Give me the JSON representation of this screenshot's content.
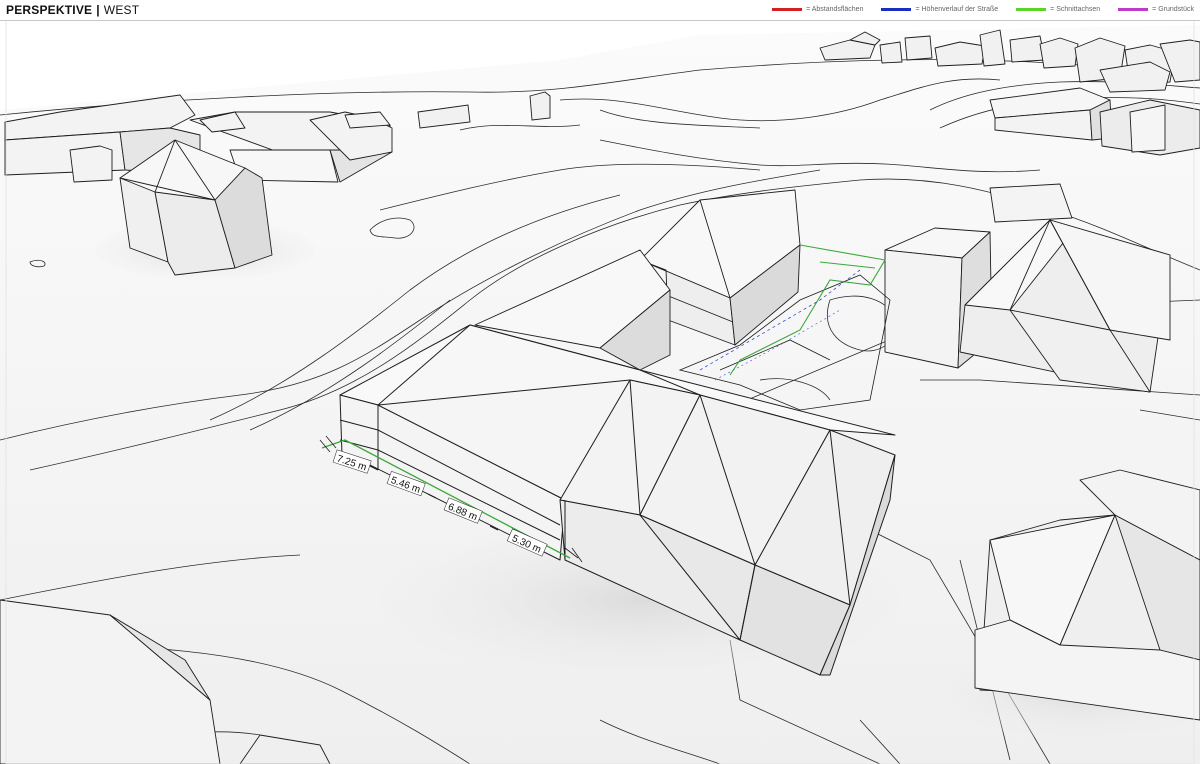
{
  "header": {
    "title_main": "PERSPEKTIVE",
    "title_separator": "|",
    "title_view": "WEST"
  },
  "legend": [
    {
      "label": "= Abstandsflächen",
      "color": "#d42020"
    },
    {
      "label": "= Höhenverlauf der Straße",
      "color": "#1a2fc0"
    },
    {
      "label": "= Schnittachsen",
      "color": "#5bd42a"
    },
    {
      "label": "= Grundstück",
      "color": "#c03ac8"
    }
  ],
  "measurements": [
    "7.25 m",
    "5.46 m",
    "6.88 m",
    "5.30 m"
  ],
  "colors": {
    "ground": "#f4f4f4",
    "building_face_light": "#f7f7f7",
    "building_face_mid": "#ececec",
    "building_face_dark": "#dadada",
    "outline": "#1e1e1e",
    "section_axis": "#3aa83a",
    "street_profile": "#3a4fc8"
  }
}
